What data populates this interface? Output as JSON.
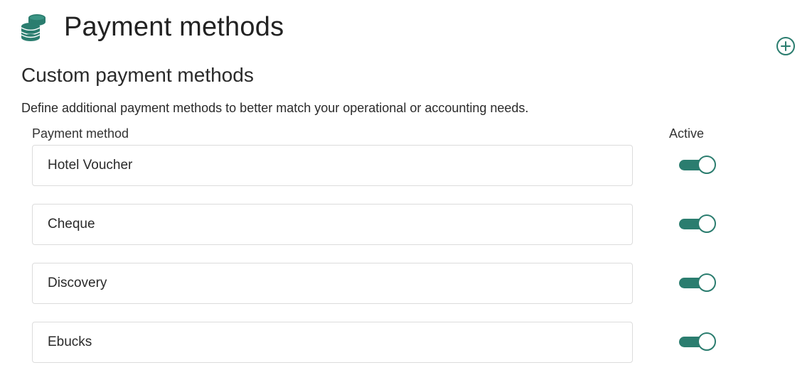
{
  "header": {
    "title": "Payment methods",
    "icon": "coins-stack-icon",
    "accent_color": "#2b7d6f"
  },
  "actions": {
    "add_icon": "plus-circle-icon"
  },
  "section": {
    "title": "Custom payment methods",
    "description": "Define additional payment methods to better match your operational or accounting needs."
  },
  "table": {
    "columns": {
      "method": "Payment method",
      "active": "Active"
    },
    "rows": [
      {
        "name": "Hotel Voucher",
        "active": true
      },
      {
        "name": "Cheque",
        "active": true
      },
      {
        "name": "Discovery",
        "active": true
      },
      {
        "name": "Ebucks",
        "active": true
      }
    ]
  }
}
